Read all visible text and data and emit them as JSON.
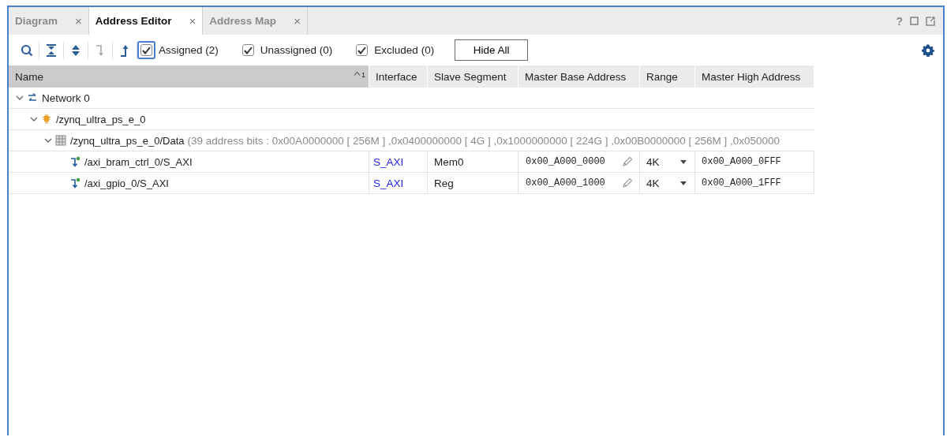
{
  "tabs": [
    {
      "label": "Diagram",
      "selected": false,
      "close": "×"
    },
    {
      "label": "Address Editor",
      "selected": true,
      "close": "×"
    },
    {
      "label": "Address Map",
      "selected": false,
      "close": "×"
    }
  ],
  "window_controls": {
    "help": "?"
  },
  "toolbar": {
    "checkboxes": [
      {
        "label": "Assigned (2)",
        "checked": true,
        "focused": true
      },
      {
        "label": "Unassigned (0)",
        "checked": true,
        "focused": false
      },
      {
        "label": "Excluded (0)",
        "checked": true,
        "focused": false
      }
    ],
    "button": "Hide All"
  },
  "table": {
    "columns": [
      {
        "label": "Name",
        "sorted": true,
        "sort_order": "1"
      },
      {
        "label": "Interface",
        "sorted": false
      },
      {
        "label": "Slave Segment",
        "sorted": false
      },
      {
        "label": "Master Base Address",
        "sorted": false
      },
      {
        "label": "Range",
        "sorted": false
      },
      {
        "label": "Master High Address",
        "sorted": false
      }
    ],
    "tree": [
      {
        "kind": "network",
        "name": "Network 0",
        "expanded": true,
        "children": [
          {
            "kind": "processor",
            "name": "/zynq_ultra_ps_e_0",
            "expanded": true,
            "children": [
              {
                "kind": "address-space",
                "name": "/zynq_ultra_ps_e_0/Data",
                "detail": "(39 address bits : 0x00A0000000 [ 256M ] ,0x0400000000 [ 4G ] ,0x1000000000 [ 224G ] ,0x00B0000000 [ 256M ] ,0x050000",
                "expanded": true,
                "children": [
                  {
                    "kind": "slave",
                    "name": "/axi_bram_ctrl_0/S_AXI",
                    "interface": "S_AXI",
                    "slave_segment": "Mem0",
                    "base": "0x00_A000_0000",
                    "range": "4K",
                    "high": "0x00_A000_0FFF"
                  },
                  {
                    "kind": "slave",
                    "name": "/axi_gpio_0/S_AXI",
                    "interface": "S_AXI",
                    "slave_segment": "Reg",
                    "base": "0x00_A000_1000",
                    "range": "4K",
                    "high": "0x00_A000_1FFF"
                  }
                ]
              }
            ]
          }
        ]
      }
    ]
  }
}
